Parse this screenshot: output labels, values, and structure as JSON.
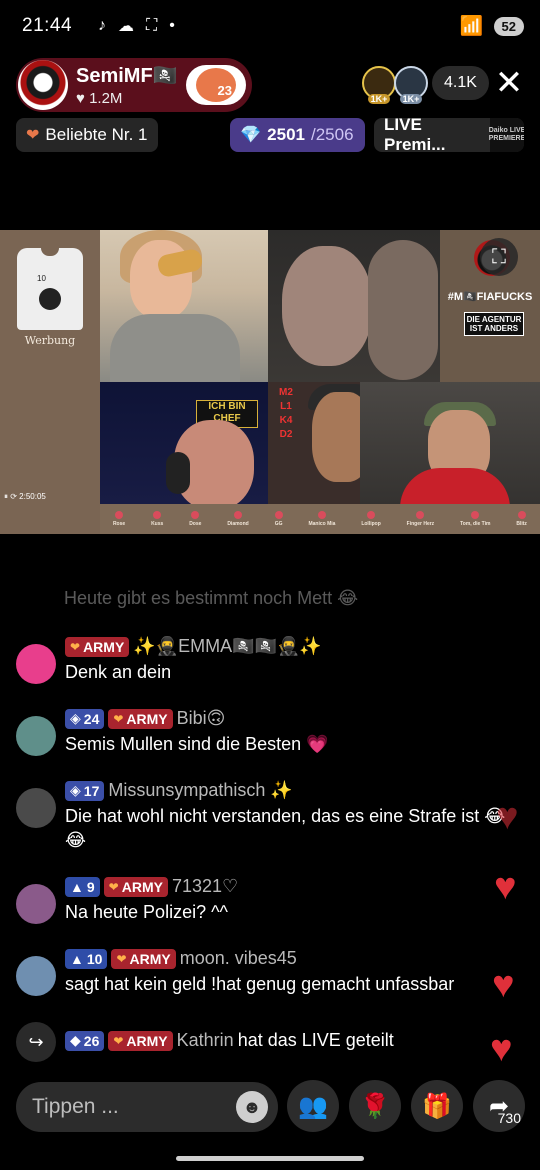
{
  "status_bar": {
    "time": "21:44",
    "icons": [
      "tiktok-icon",
      "cloud-icon",
      "screenshot-icon",
      "dot-icon"
    ],
    "battery": "52"
  },
  "host": {
    "name": "SemiMF🏴‍☠️",
    "likes": "♥ 1.2M",
    "follow_badge": "23"
  },
  "viewers": {
    "badges": [
      "1K+",
      "1K+"
    ],
    "count": "4.1K"
  },
  "chips": {
    "rank": "Beliebte Nr. 1",
    "progress_current": "2501",
    "progress_total": "/2506",
    "live": "LIVE Premi...",
    "live_badge": "Daiko LIVE PREMIERE"
  },
  "video": {
    "werbung_label": "Werbung",
    "shirt_number": "10",
    "brand_tag": "#M🏴‍☠️FIAFUCKS",
    "agentur": "DIE AGENTUR IST ANDERS",
    "chef_badge": "ICH BIN CHEF",
    "mlk": "M2 L1 K4 D2",
    "control_time": "2:50:05",
    "gift_labels": [
      "Rose",
      "Kuss",
      "Dose",
      "Diamond",
      "GG",
      "Manico Mia",
      "Lollipop",
      "Finger Herz",
      "Tom, die Tim",
      "Blitz"
    ]
  },
  "chat": {
    "faded": "Heute gibt es bestimmt noch Mett 😂",
    "messages": [
      {
        "level": "",
        "army": "ARMY",
        "name": "✨🥷EMMA🏴‍☠️🏴‍☠️🥷✨",
        "text": "Denk an dein"
      },
      {
        "level": "24",
        "army": "ARMY",
        "name": "Bibi🙃",
        "text": "Semis Mullen sind die Besten 💗"
      },
      {
        "level": "17",
        "army": "",
        "name": "Missunsympathisch ✨",
        "text": "Die hat wohl nicht verstanden, das es eine Strafe ist 😂😂"
      },
      {
        "level": "9",
        "army": "ARMY",
        "name": "71321♡",
        "text": "Na heute Polizei? ^^"
      },
      {
        "level": "10",
        "army": "ARMY",
        "name": "moon. vibes45",
        "text": "sagt hat kein geld !hat genug gemacht unfassbar"
      }
    ],
    "share_event": {
      "level": "26",
      "army": "ARMY",
      "name": "Kathrin",
      "text": "hat das LIVE geteilt"
    }
  },
  "bottom_bar": {
    "placeholder": "Tippen ...",
    "share_count": "730"
  },
  "colors": {
    "host_pill": "#5b0f1c",
    "army_badge": "#a8242e",
    "level_badge": "#3b4fa8",
    "progress_chip": "#4a3b8a",
    "heart": "#e0303a"
  }
}
